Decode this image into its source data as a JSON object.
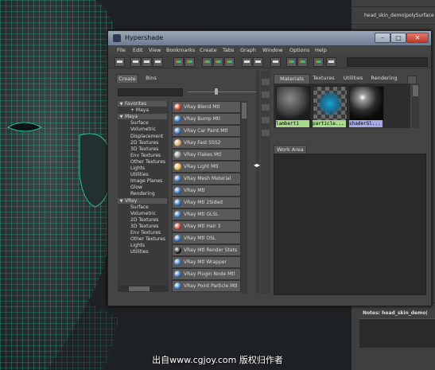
{
  "hypershade": {
    "title": "Hypershade",
    "menus": [
      "File",
      "Edit",
      "View",
      "Bookmarks",
      "Create",
      "Tabs",
      "Graph",
      "Window",
      "Options",
      "Help"
    ],
    "left_tabs": [
      "Create",
      "Bins"
    ],
    "tree": [
      {
        "label": "Favorites",
        "header": true,
        "expanded": true
      },
      {
        "label": "+ Maya",
        "header": false
      },
      {
        "label": "Maya",
        "header": true,
        "expanded": true
      },
      {
        "label": "Surface",
        "header": false
      },
      {
        "label": "Volumetric",
        "header": false
      },
      {
        "label": "Displacement",
        "header": false
      },
      {
        "label": "2D Textures",
        "header": false
      },
      {
        "label": "3D Textures",
        "header": false
      },
      {
        "label": "Env Textures",
        "header": false
      },
      {
        "label": "Other Textures",
        "header": false
      },
      {
        "label": "Lights",
        "header": false
      },
      {
        "label": "Utilities",
        "header": false
      },
      {
        "label": "Image Planes",
        "header": false
      },
      {
        "label": "Glow",
        "header": false
      },
      {
        "label": "Rendering",
        "header": false
      },
      {
        "label": "VRay",
        "header": true,
        "expanded": true
      },
      {
        "label": "Surface",
        "header": false
      },
      {
        "label": "Volumetric",
        "header": false
      },
      {
        "label": "2D Textures",
        "header": false
      },
      {
        "label": "3D Textures",
        "header": false
      },
      {
        "label": "Env Textures",
        "header": false
      },
      {
        "label": "Other Textures",
        "header": false
      },
      {
        "label": "Lights",
        "header": false
      },
      {
        "label": "Utilities",
        "header": false
      }
    ],
    "nodes": [
      {
        "label": "VRay Blend Mtl",
        "color": "#c0392b"
      },
      {
        "label": "VRay Bump Mtl",
        "color": "#2a6ab0"
      },
      {
        "label": "VRay Car Paint Mtl",
        "color": "#2a6ab0"
      },
      {
        "label": "VRay Fast SSS2",
        "color": "#d9a066"
      },
      {
        "label": "VRay Flakes Mtl",
        "color": "#8a8a8a"
      },
      {
        "label": "VRay Light Mtl",
        "color": "#e8b040"
      },
      {
        "label": "VRay Mesh Material",
        "color": "#2a6ab0"
      },
      {
        "label": "VRay Mtl",
        "color": "#2a6ab0"
      },
      {
        "label": "VRay Mtl 2Sided",
        "color": "#2a6ab0"
      },
      {
        "label": "VRay Mtl GLSL",
        "color": "#2a6ab0"
      },
      {
        "label": "VRay Mtl Hair 3",
        "color": "#c0392b"
      },
      {
        "label": "VRay Mtl OSL",
        "color": "#2a6ab0"
      },
      {
        "label": "VRay Mtl Render Stats",
        "color": "#111111"
      },
      {
        "label": "VRay Mtl Wrapper",
        "color": "#2a6ab0"
      },
      {
        "label": "VRay Plugin Node Mtl",
        "color": "#2a6ab0"
      },
      {
        "label": "VRay Point Particle Mtl",
        "color": "#2a6ab0"
      }
    ],
    "right_tabs": [
      "Materials",
      "Textures",
      "Utilities",
      "Rendering"
    ],
    "materials": [
      {
        "label": "lambert1",
        "label_bg": "#a8d88c"
      },
      {
        "label": "particle...",
        "label_bg": "#a8d88c"
      },
      {
        "label": "shaderGl...",
        "label_bg": "#a8a8e8"
      }
    ],
    "work_area_tab": "Work Area"
  },
  "right_panel": {
    "node_name": "head_skin_demo|polySurface",
    "notes_label": "Notes: head_skin_demo|"
  },
  "subtitle": "出自www.cgjoy.com 版权归作者"
}
